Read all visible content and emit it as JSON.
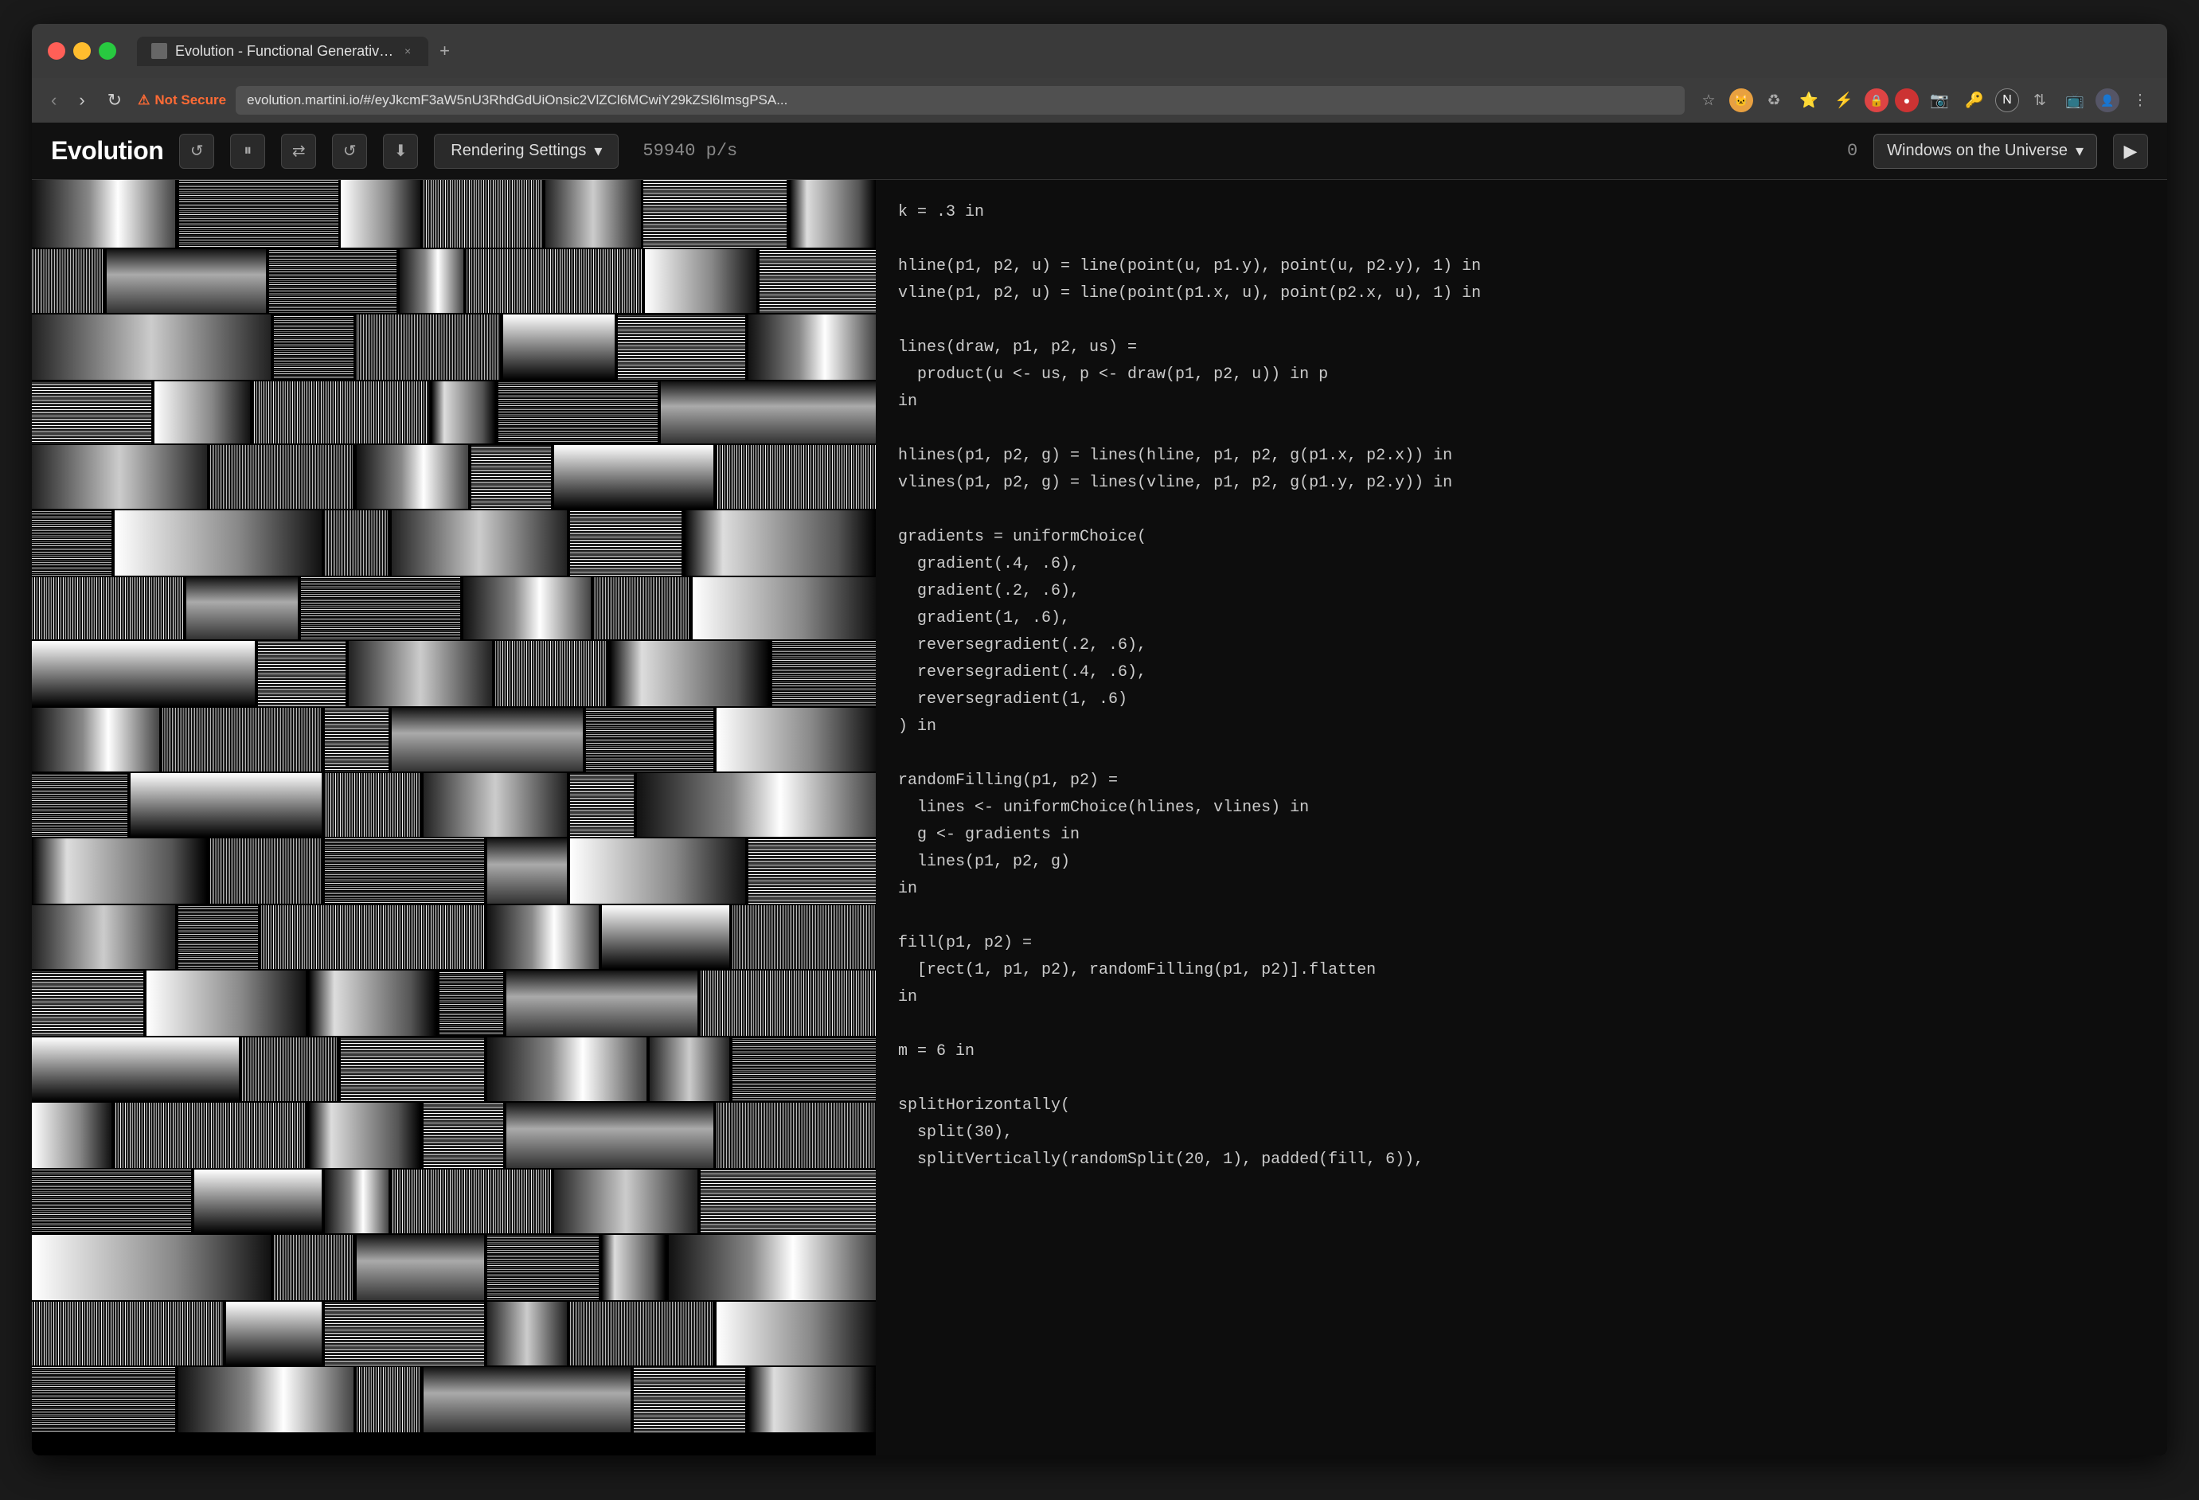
{
  "browser": {
    "tab_title": "Evolution - Functional Generativ…",
    "new_tab_label": "+",
    "nav": {
      "back": "←",
      "forward": "→",
      "refresh": "↻",
      "security_text": "Not Secure",
      "url": "evolution.martini.io/#/eyJkcmF3aW5nU3RhdGdUiOnsic2VlZCl6MCwiY29kZSl6ImsgPSA..."
    },
    "actions": [
      "☆",
      "🐱",
      "♻",
      "⭐",
      "⚡",
      "🔒",
      "🔴",
      "📷",
      "🔐",
      "N",
      "⇅",
      "📺",
      "👤",
      "⋮"
    ]
  },
  "app": {
    "logo": "Evolution",
    "header_buttons": {
      "reload": "↺",
      "pause": "⏸",
      "shuffle": "⇄",
      "reset": "↺",
      "download": "⬇"
    },
    "rendering_settings": "Rendering Settings",
    "speed": "59940 p/s",
    "counter": "0",
    "preset_name": "Windows on the Universe",
    "next_icon": "▶"
  },
  "code": {
    "lines": [
      "k = .3 in",
      "",
      "hline(p1, p2, u) = line(point(u, p1.y), point(u, p2.y), 1) in",
      "vline(p1, p2, u) = line(point(p1.x, u), point(p2.x, u), 1) in",
      "",
      "lines(draw, p1, p2, us) =",
      "  product(u <- us, p <- draw(p1, p2, u)) in p",
      "in",
      "",
      "hlines(p1, p2, g) = lines(hline, p1, p2, g(p1.x, p2.x)) in",
      "vlines(p1, p2, g) = lines(vline, p1, p2, g(p1.y, p2.y)) in",
      "",
      "gradients = uniformChoice(",
      "  gradient(.4, .6),",
      "  gradient(.2, .6),",
      "  gradient(1, .6),",
      "  reversegradient(.2, .6),",
      "  reversegradient(.4, .6),",
      "  reversegradient(1, .6)",
      ") in",
      "",
      "randomFilling(p1, p2) =",
      "  lines <- uniformChoice(hlines, vlines) in",
      "  g <- gradients in",
      "  lines(p1, p2, g)",
      "in",
      "",
      "fill(p1, p2) =",
      "  [rect(1, p1, p2), randomFilling(p1, p2)].flatten",
      "in",
      "",
      "m = 6 in",
      "",
      "splitHorizontally(",
      "  split(30),",
      "  splitVertically(randomSplit(20, 1), padded(fill, 6)),"
    ]
  },
  "colors": {
    "background": "#000000",
    "panel_bg": "#0d0d0d",
    "header_bg": "#111111",
    "text_primary": "#cccccc",
    "text_dim": "#888888",
    "accent_orange": "#ff6b35"
  }
}
